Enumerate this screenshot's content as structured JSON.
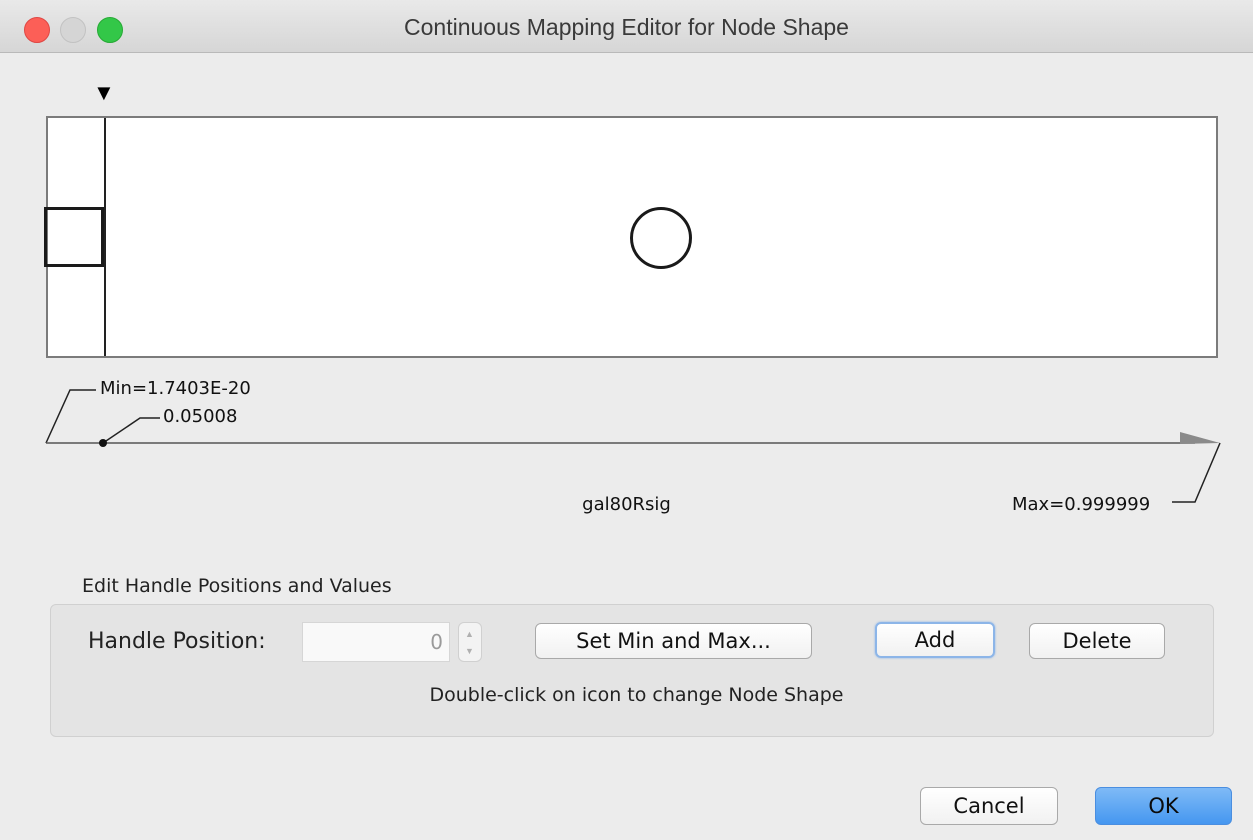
{
  "window": {
    "title": "Continuous Mapping Editor for Node Shape"
  },
  "mapping": {
    "min_label": "Min=1.7403E-20",
    "handle_value_label": "0.05008",
    "attribute_name": "gal80Rsig",
    "max_label": "Max=0.999999",
    "handle_position_fraction": 0.05008,
    "below_shape": "square-icon",
    "above_shape": "circle-icon"
  },
  "edit_group": {
    "title": "Edit Handle Positions and Values",
    "handle_position_label": "Handle Position:",
    "handle_position_value": "0",
    "set_min_max_label": "Set Min and Max...",
    "add_label": "Add",
    "delete_label": "Delete",
    "hint": "Double-click on icon to change Node Shape"
  },
  "footer": {
    "cancel_label": "Cancel",
    "ok_label": "OK"
  },
  "colors": {
    "close": "#fc5f57",
    "zoom": "#33c748",
    "ok_button": "#4597f0",
    "focus_ring": "#8cb5e8"
  }
}
